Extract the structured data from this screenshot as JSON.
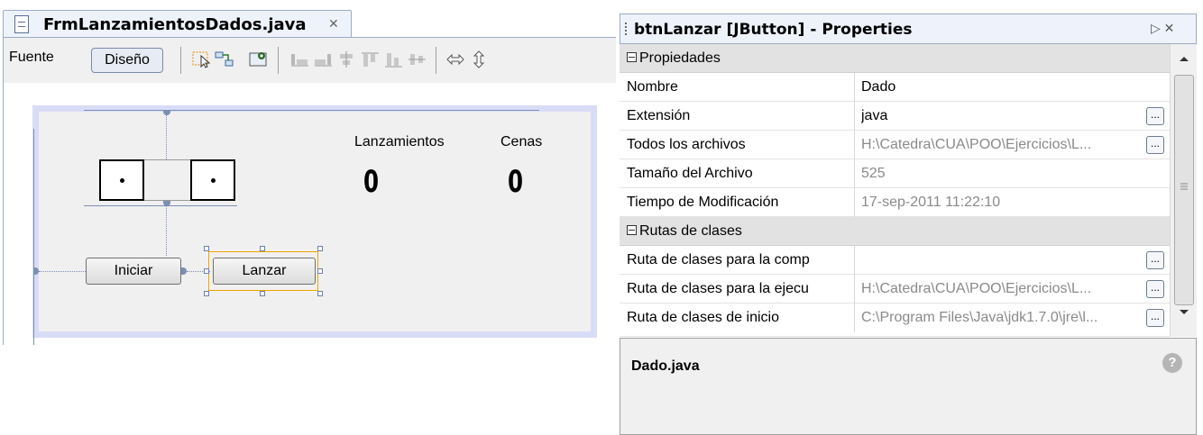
{
  "editor": {
    "tab_title": "FrmLanzamientosDados.java",
    "tab_close": "✕",
    "source_label": "Fuente",
    "design_label": "Diseño"
  },
  "form": {
    "label_launches": "Lanzamientos",
    "label_dinners": "Cenas",
    "count_launches": "0",
    "count_dinners": "0",
    "btn_start": "Iniciar",
    "btn_launch": "Lanzar"
  },
  "properties": {
    "title": "btnLanzar [JButton] - Properties",
    "categories": [
      {
        "label": "Propiedades"
      },
      {
        "label": "Rutas de clases"
      }
    ],
    "rows": [
      {
        "name": "Nombre",
        "value": "Dado"
      },
      {
        "name": "Extensión",
        "value": "java"
      },
      {
        "name": "Todos los archivos",
        "value": "H:\\Catedra\\CUA\\POO\\Ejercicios\\L..."
      },
      {
        "name": "Tamaño del Archivo",
        "value": "525"
      },
      {
        "name": "Tiempo de Modificación",
        "value": "17-sep-2011 11:22:10"
      },
      {
        "name": "Ruta de clases para la comp",
        "value": ""
      },
      {
        "name": "Ruta de clases para la ejecu",
        "value": "H:\\Catedra\\CUA\\POO\\Ejercicios\\L..."
      },
      {
        "name": "Ruta de clases de inicio",
        "value": "C:\\Program Files\\Java\\jdk1.7.0\\jre\\l..."
      }
    ],
    "ellipsis": "...",
    "description_title": "Dado.java",
    "help": "?"
  }
}
